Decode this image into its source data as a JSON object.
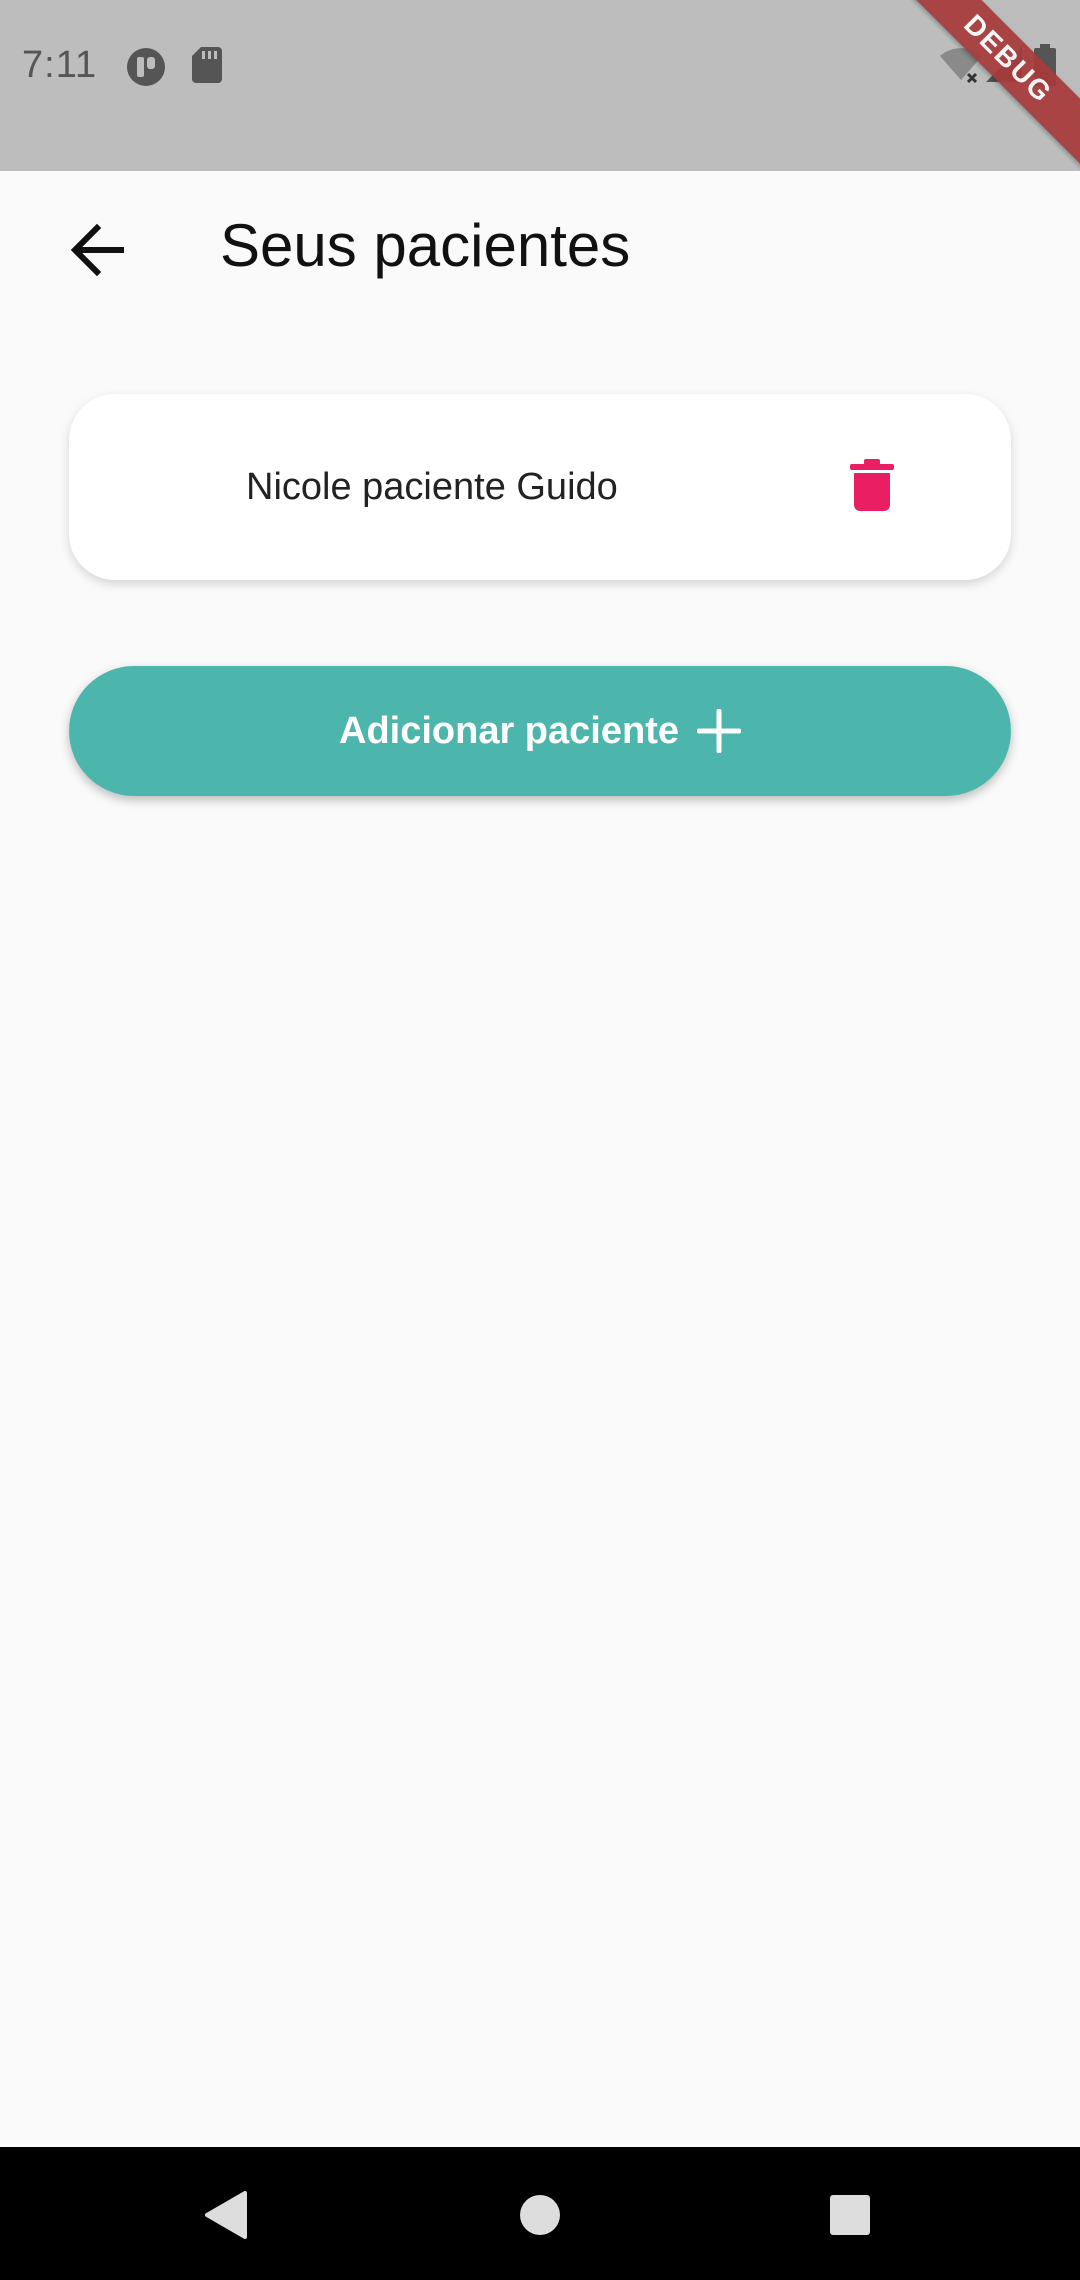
{
  "status_bar": {
    "time": "7:11",
    "icons": [
      "app-notification-icon",
      "sd-card-icon",
      "wifi-off-icon",
      "signal-icon",
      "battery-icon"
    ],
    "debug_label": "DEBUG"
  },
  "app_bar": {
    "title": "Seus pacientes",
    "back_icon": "arrow-back-icon"
  },
  "patients": [
    {
      "name": "Nicole paciente Guido",
      "action_icon": "trash-icon"
    }
  ],
  "add_button": {
    "label": "Adicionar paciente",
    "icon": "plus-icon"
  },
  "navigation": {
    "icons": [
      "back-triangle-icon",
      "home-circle-icon",
      "recents-square-icon"
    ]
  },
  "colors": {
    "accent": "#4db6ac",
    "delete": "#e91e63",
    "status_bar": "#bdbdbd",
    "background": "#fafafa"
  }
}
